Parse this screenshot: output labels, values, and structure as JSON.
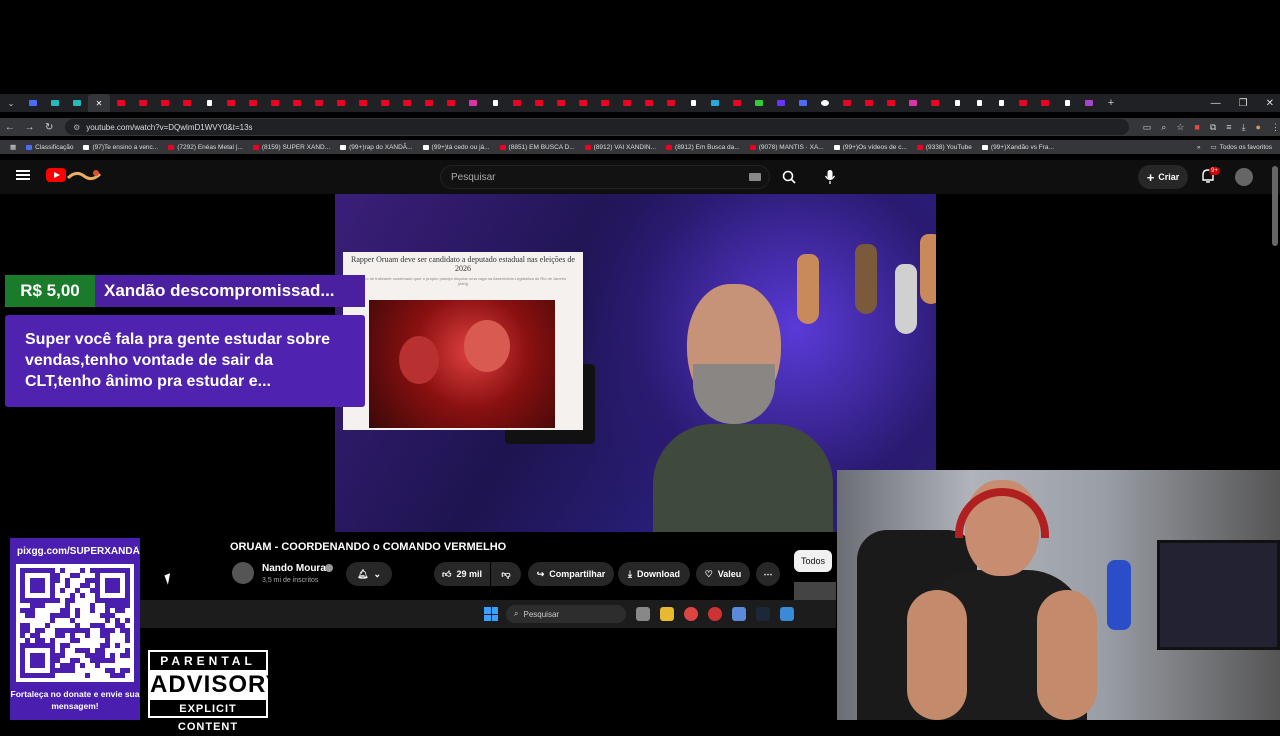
{
  "browser": {
    "url": "youtube.com/watch?v=DQwlmD1WVY0&t=13s",
    "bookmarks": [
      {
        "label": "Classificação"
      },
      {
        "label": "(97)Te ensino a venc..."
      },
      {
        "label": "(7292) Enéas Metal |..."
      },
      {
        "label": "(8159) SUPER XAND..."
      },
      {
        "label": "(99+)rap do XANDÃ..."
      },
      {
        "label": "(99+)tá cedo ou já..."
      },
      {
        "label": "(8851) EM BUSCA D..."
      },
      {
        "label": "(8912) VAI XANDIN..."
      },
      {
        "label": "(8912) Em Busca da..."
      },
      {
        "label": "(9078) MANTIS · XA..."
      },
      {
        "label": "(99+)Os vídeos de c..."
      },
      {
        "label": "(9338) YouTube"
      },
      {
        "label": "(99+)Xandão vs Fra..."
      }
    ],
    "all_bookmarks_label": "Todos os favoritos"
  },
  "youtube": {
    "search_placeholder": "Pesquisar",
    "create_label": "Criar",
    "notification_badge": "9+",
    "video": {
      "title": "ORUAM - COORDENANDO o COMANDO VERMELHO",
      "channel_name": "Nando Moura",
      "subscribers": "3,5 mi de inscritos",
      "likes": "29 mil",
      "share_label": "Compartilhar",
      "download_label": "Download",
      "valeu_label": "Valeu",
      "chip_label": "Todos"
    },
    "article": {
      "headline": "Rapper Oruam deve ser candidato a deputado estadual nas eleições de 2026",
      "subline": "Filho de traficante condenado quer o próprio planeja disputar uma vaga na Assembleia Legislativa do Rio de Janeiro (Alerj)"
    }
  },
  "superchat": {
    "amount": "R$ 5,00",
    "name": "Xandão descompromissad...",
    "message": "Super você fala pra gente estudar sobre vendas,tenho vontade de sair da CLT,tenho ânimo pra estudar e..."
  },
  "qr_panel": {
    "url": "pixgg.com/SUPERXANDÃO",
    "note": "Fortaleça no donate e envie sua mensagem!"
  },
  "parental_advisory": {
    "top": "PARENTAL",
    "middle": "ADVISORY",
    "bottom": "EXPLICIT CONTENT"
  },
  "taskbar": {
    "search_label": "Pesquisar"
  },
  "colors": {
    "superchat_green": "#1a7b2a",
    "superchat_purple": "#4f22b0",
    "youtube_red": "#ff0000"
  }
}
